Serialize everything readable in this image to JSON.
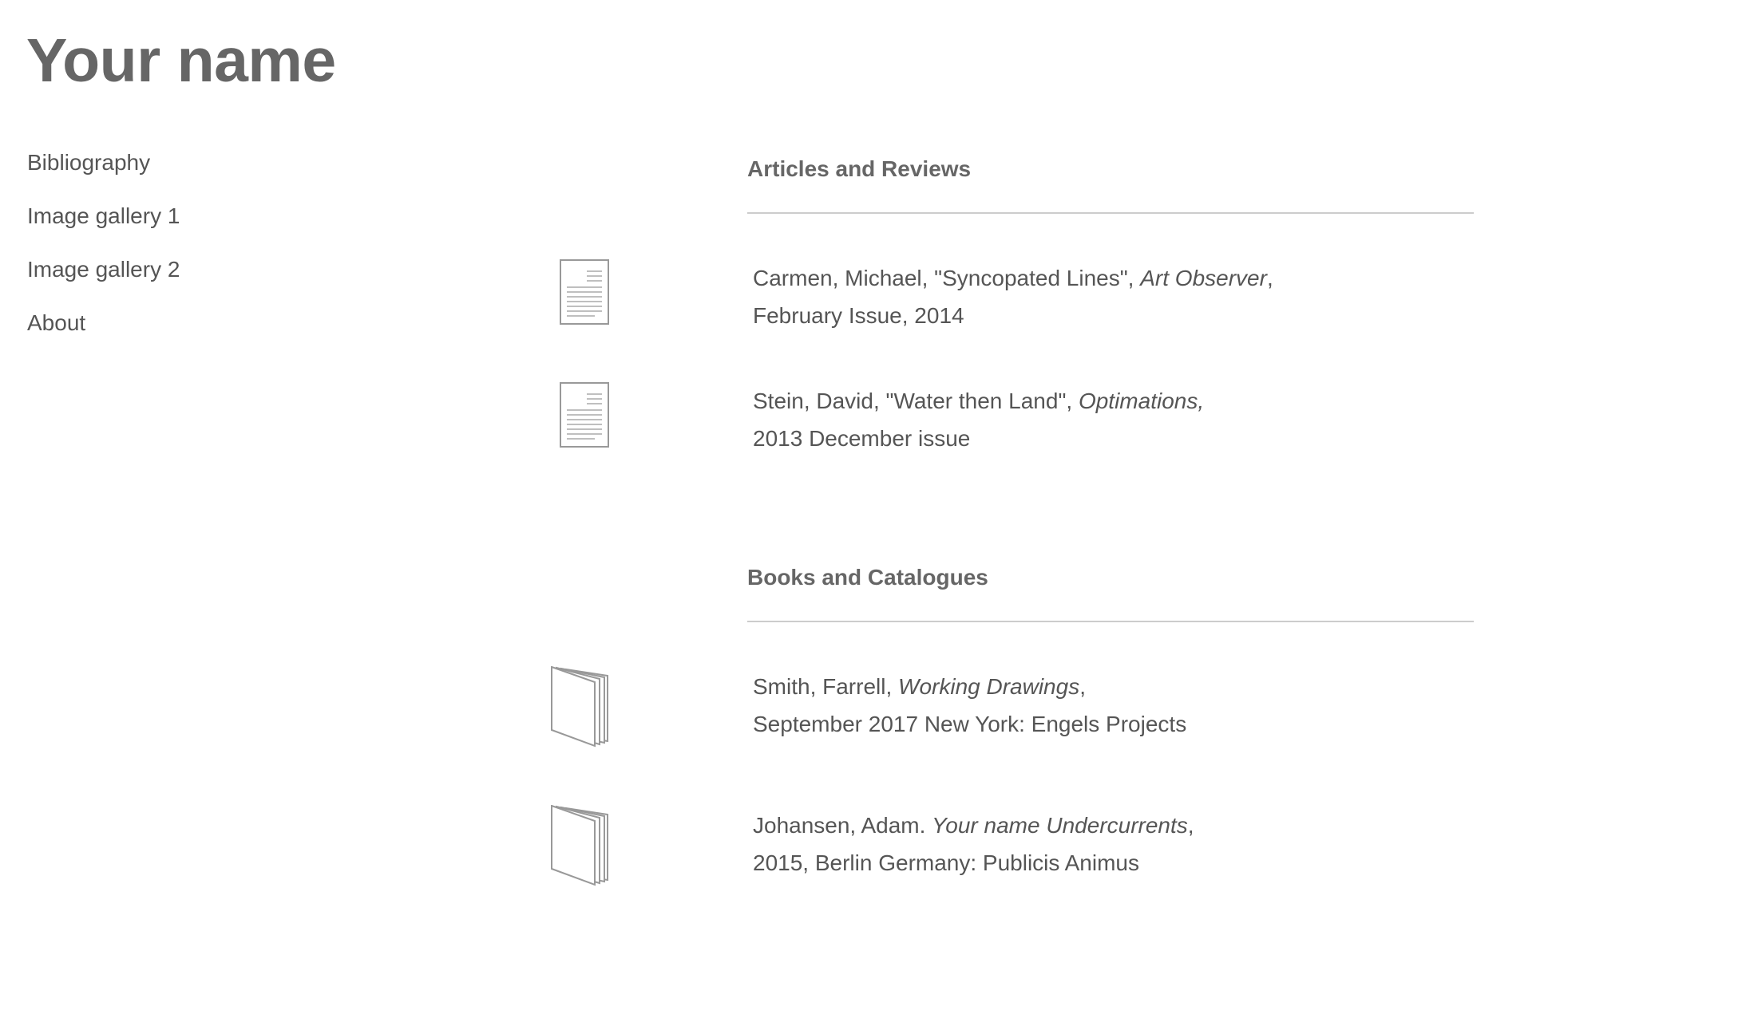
{
  "site": {
    "title": "Your name"
  },
  "nav": {
    "items": [
      {
        "label": "Bibliography"
      },
      {
        "label": "Image gallery 1"
      },
      {
        "label": "Image gallery 2"
      },
      {
        "label": "About"
      }
    ]
  },
  "sections": [
    {
      "heading": "Articles and Reviews",
      "icon": "document-icon",
      "entries": [
        {
          "line1_plain": "Carmen, Michael, \"Syncopated Lines\", ",
          "line1_italic": "Art Observer",
          "line1_tail": ",",
          "line2": "February Issue, 2014"
        },
        {
          "line1_plain": "Stein, David, \"Water then Land\", ",
          "line1_italic": "Optimations,",
          "line1_tail": "",
          "line2": "2013 December issue"
        }
      ]
    },
    {
      "heading": "Books and Catalogues",
      "icon": "booklet-icon",
      "entries": [
        {
          "line1_plain": "Smith, Farrell, ",
          "line1_italic": "Working Drawings",
          "line1_tail": ",",
          "line2": "September 2017 New York: Engels Projects"
        },
        {
          "line1_plain": "Johansen, Adam. ",
          "line1_italic": "Your name Undercurrents",
          "line1_tail": ",",
          "line2": "2015, Berlin Germany: Publicis Animus"
        }
      ]
    }
  ],
  "colors": {
    "text": "#666666",
    "body_text": "#555555",
    "rule": "#cccccc",
    "icon_stroke": "#999999"
  }
}
